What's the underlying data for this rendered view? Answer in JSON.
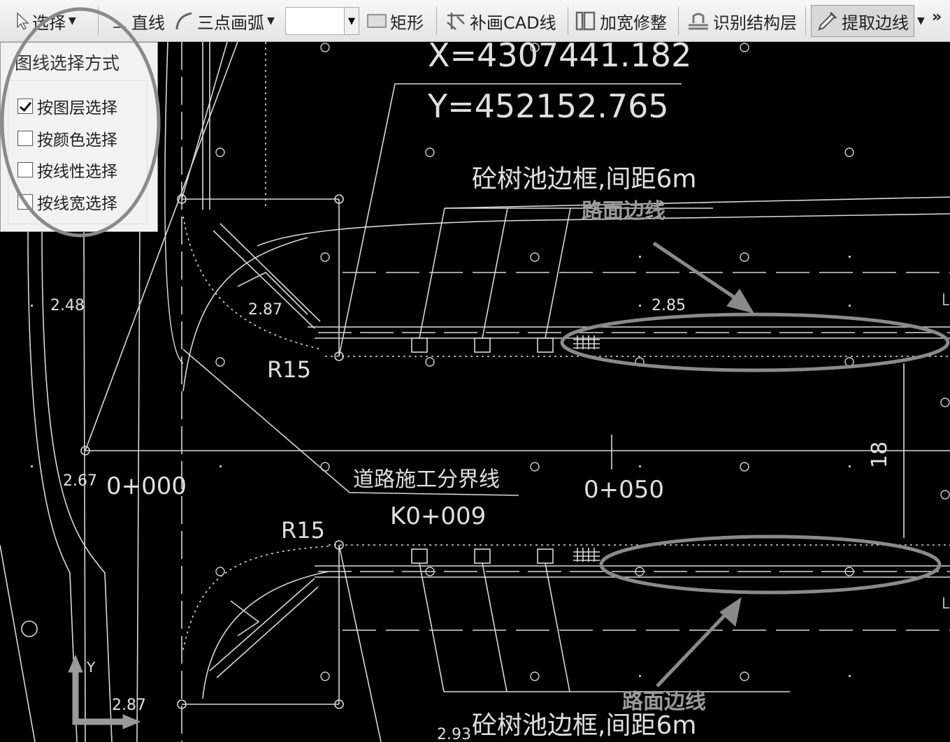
{
  "toolbar": {
    "select_label": "选择",
    "line_label": "直线",
    "arc_label": "三点画弧",
    "rect_label": "矩形",
    "cad_line_label": "补画CAD线",
    "widen_label": "加宽修整",
    "layer_label": "识别结构层",
    "extract_label": "提取边线",
    "more_label": "»"
  },
  "panel": {
    "title": "图线选择方式",
    "options": [
      {
        "label": "按图层选择",
        "checked": true
      },
      {
        "label": "按颜色选择",
        "checked": false
      },
      {
        "label": "按线性选择",
        "checked": false
      },
      {
        "label": "按线宽选择",
        "checked": false
      }
    ]
  },
  "drawing": {
    "coord_x": "X=4307441.182",
    "coord_y": "Y=452152.765",
    "tree_label_top": "砼树池边框,间距6m",
    "road_edge_top": "路面边线",
    "elev_248": "2.48",
    "elev_287": "2.87",
    "elev_285": "2.85",
    "r15_top": "R15",
    "r15_bottom": "R15",
    "elev_267": "2.67",
    "station_0": "0+000",
    "boundary_label": "道路施工分界线",
    "station_k": "K0+009",
    "station_50": "0+050",
    "width_18": "18",
    "axis_y": "Y",
    "elev_287b": "2.87",
    "elev_293": "2.93",
    "tree_label_bottom": "砼树池边框,间距6m",
    "road_edge_bottom": "路面边线"
  },
  "colors": {
    "cad_line": "#d9d9d9",
    "highlight": "#8a8a8a",
    "background": "#000000"
  }
}
